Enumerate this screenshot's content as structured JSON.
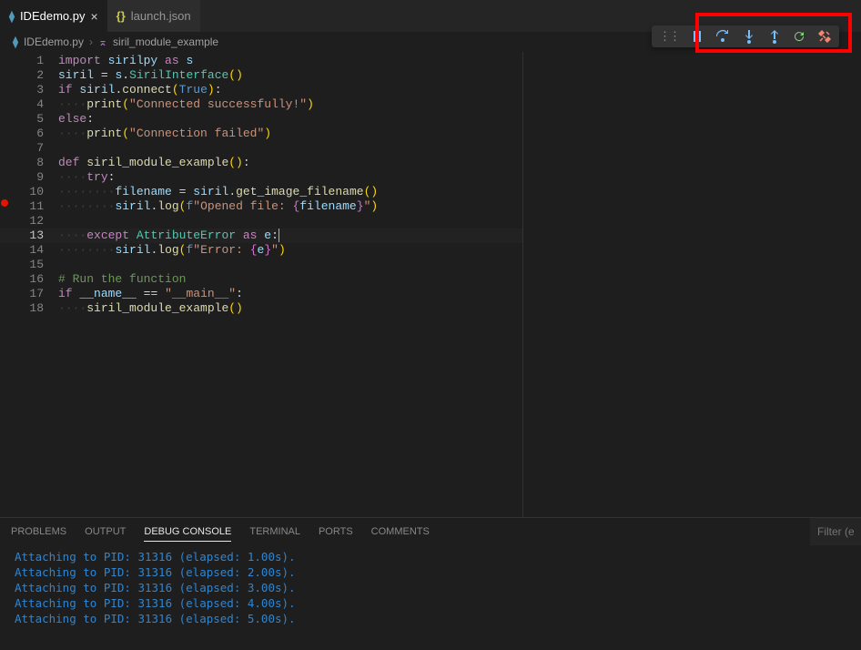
{
  "tabs": [
    {
      "icon": "python",
      "label": "IDEdemo.py",
      "active": true,
      "closable": true
    },
    {
      "icon": "json",
      "label": "launch.json",
      "active": false,
      "closable": false
    }
  ],
  "breadcrumb": {
    "file_icon": "python",
    "file": "IDEdemo.py",
    "symbol_icon": "method",
    "symbol": "siril_module_example"
  },
  "debug_toolbar": {
    "buttons": [
      "drag-handle",
      "pause",
      "step-over",
      "step-into",
      "step-out",
      "restart",
      "disconnect"
    ]
  },
  "editor": {
    "breakpoints": [
      11
    ],
    "cursor_line": 13,
    "lines": [
      {
        "n": 1,
        "tokens": [
          [
            "kw",
            "import"
          ],
          [
            "op",
            " "
          ],
          [
            "var",
            "sirilpy"
          ],
          [
            "op",
            " "
          ],
          [
            "kw",
            "as"
          ],
          [
            "op",
            " "
          ],
          [
            "var",
            "s"
          ]
        ]
      },
      {
        "n": 2,
        "tokens": [
          [
            "var",
            "siril"
          ],
          [
            "op",
            " "
          ],
          [
            "op",
            "="
          ],
          [
            "op",
            " "
          ],
          [
            "var",
            "s"
          ],
          [
            "op",
            "."
          ],
          [
            "cls",
            "SirilInterface"
          ],
          [
            "par",
            "()"
          ]
        ]
      },
      {
        "n": 3,
        "tokens": [
          [
            "kw",
            "if"
          ],
          [
            "op",
            " "
          ],
          [
            "var",
            "siril"
          ],
          [
            "op",
            "."
          ],
          [
            "fn",
            "connect"
          ],
          [
            "par",
            "("
          ],
          [
            "const",
            "True"
          ],
          [
            "par",
            ")"
          ],
          [
            "op",
            ":"
          ]
        ]
      },
      {
        "n": 4,
        "indent": 1,
        "tokens": [
          [
            "fn",
            "print"
          ],
          [
            "par",
            "("
          ],
          [
            "str",
            "\"Connected successfully!\""
          ],
          [
            "par",
            ")"
          ]
        ]
      },
      {
        "n": 5,
        "tokens": [
          [
            "kw",
            "else"
          ],
          [
            "op",
            ":"
          ]
        ]
      },
      {
        "n": 6,
        "indent": 1,
        "tokens": [
          [
            "fn",
            "print"
          ],
          [
            "par",
            "("
          ],
          [
            "str",
            "\"Connection failed\""
          ],
          [
            "par",
            ")"
          ]
        ]
      },
      {
        "n": 7,
        "tokens": []
      },
      {
        "n": 8,
        "tokens": [
          [
            "kw",
            "def"
          ],
          [
            "op",
            " "
          ],
          [
            "fn",
            "siril_module_example"
          ],
          [
            "par",
            "()"
          ],
          [
            "op",
            ":"
          ]
        ]
      },
      {
        "n": 9,
        "indent": 1,
        "tokens": [
          [
            "kw",
            "try"
          ],
          [
            "op",
            ":"
          ]
        ]
      },
      {
        "n": 10,
        "indent": 2,
        "tokens": [
          [
            "var",
            "filename"
          ],
          [
            "op",
            " "
          ],
          [
            "op",
            "="
          ],
          [
            "op",
            " "
          ],
          [
            "var",
            "siril"
          ],
          [
            "op",
            "."
          ],
          [
            "fn",
            "get_image_filename"
          ],
          [
            "par",
            "()"
          ]
        ]
      },
      {
        "n": 11,
        "indent": 2,
        "tokens": [
          [
            "var",
            "siril"
          ],
          [
            "op",
            "."
          ],
          [
            "fn",
            "log"
          ],
          [
            "par",
            "("
          ],
          [
            "const",
            "f"
          ],
          [
            "str",
            "\"Opened file: "
          ],
          [
            "par2",
            "{"
          ],
          [
            "var",
            "filename"
          ],
          [
            "par2",
            "}"
          ],
          [
            "str",
            "\""
          ],
          [
            "par",
            ")"
          ]
        ]
      },
      {
        "n": 12,
        "tokens": []
      },
      {
        "n": 13,
        "indent": 1,
        "tokens": [
          [
            "kw",
            "except"
          ],
          [
            "op",
            " "
          ],
          [
            "cls",
            "AttributeError"
          ],
          [
            "op",
            " "
          ],
          [
            "kw",
            "as"
          ],
          [
            "op",
            " "
          ],
          [
            "var",
            "e"
          ],
          [
            "op",
            ":"
          ]
        ]
      },
      {
        "n": 14,
        "indent": 2,
        "tokens": [
          [
            "var",
            "siril"
          ],
          [
            "op",
            "."
          ],
          [
            "fn",
            "log"
          ],
          [
            "par",
            "("
          ],
          [
            "const",
            "f"
          ],
          [
            "str",
            "\"Error: "
          ],
          [
            "par2",
            "{"
          ],
          [
            "var",
            "e"
          ],
          [
            "par2",
            "}"
          ],
          [
            "str",
            "\""
          ],
          [
            "par",
            ")"
          ]
        ]
      },
      {
        "n": 15,
        "tokens": []
      },
      {
        "n": 16,
        "tokens": [
          [
            "cmt",
            "# Run the function"
          ]
        ]
      },
      {
        "n": 17,
        "tokens": [
          [
            "kw",
            "if"
          ],
          [
            "op",
            " "
          ],
          [
            "var",
            "__name__"
          ],
          [
            "op",
            " "
          ],
          [
            "op",
            "=="
          ],
          [
            "op",
            " "
          ],
          [
            "str",
            "\"__main__\""
          ],
          [
            "op",
            ":"
          ]
        ]
      },
      {
        "n": 18,
        "indent": 1,
        "tokens": [
          [
            "fn",
            "siril_module_example"
          ],
          [
            "par",
            "()"
          ]
        ]
      }
    ]
  },
  "panel": {
    "tabs": [
      "PROBLEMS",
      "OUTPUT",
      "DEBUG CONSOLE",
      "TERMINAL",
      "PORTS",
      "COMMENTS"
    ],
    "active_tab": "DEBUG CONSOLE",
    "filter_placeholder": "Filter (e.g. t",
    "output": [
      "Attaching to PID: 31316 (elapsed: 1.00s).",
      "Attaching to PID: 31316 (elapsed: 2.00s).",
      "Attaching to PID: 31316 (elapsed: 3.00s).",
      "Attaching to PID: 31316 (elapsed: 4.00s).",
      "Attaching to PID: 31316 (elapsed: 5.00s)."
    ]
  }
}
